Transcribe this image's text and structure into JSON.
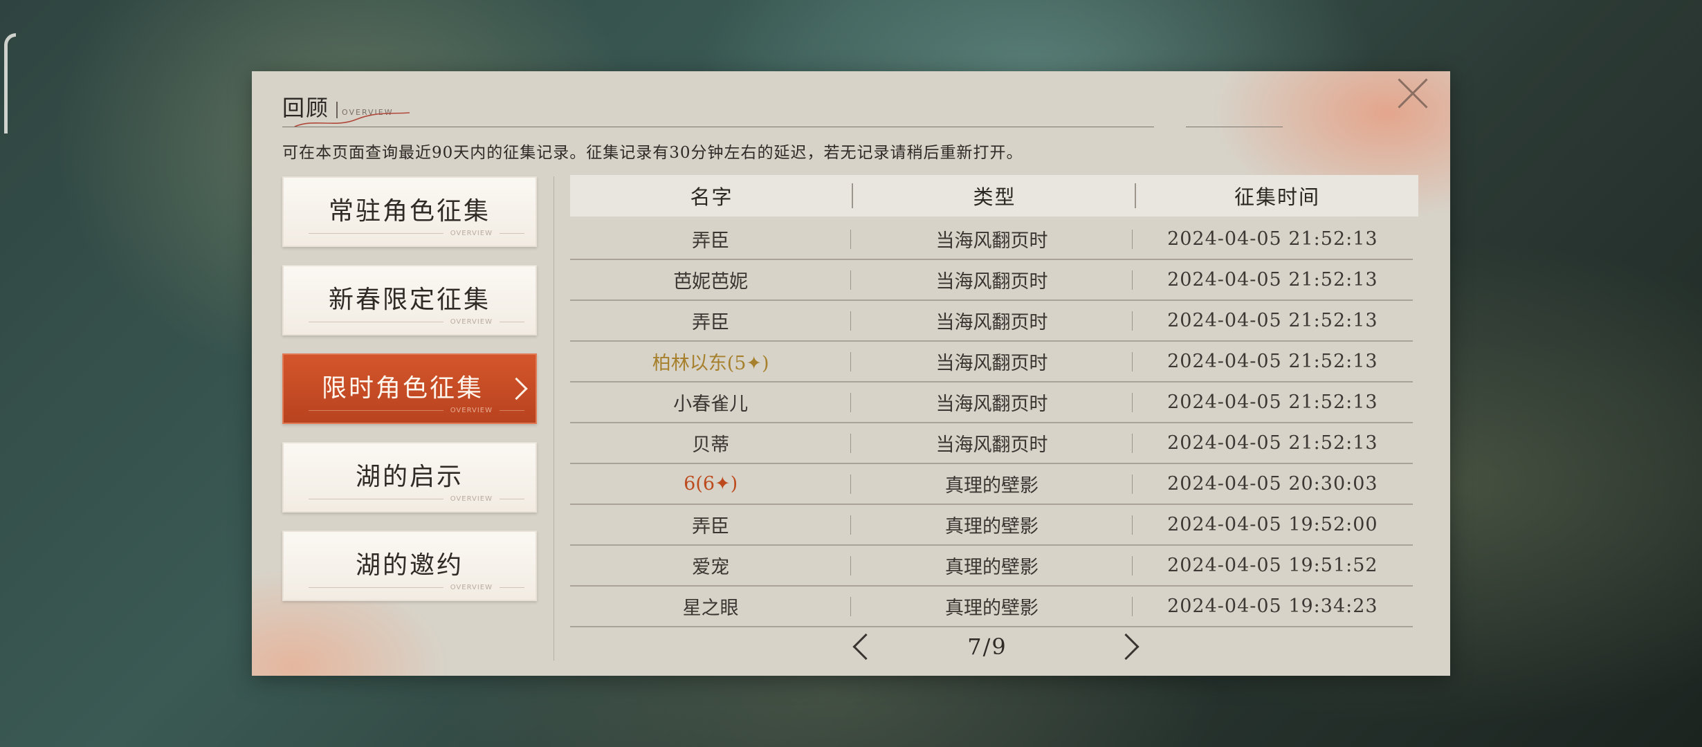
{
  "dialog": {
    "title": "回顾",
    "title_sub": "OVERVIEW",
    "notice": "可在本页面查询最近90天内的征集记录。征集记录有30分钟左右的延迟，若无记录请稍后重新打开。"
  },
  "sidebar": {
    "deco_text": "OVERVIEW",
    "items": [
      {
        "label": "常驻角色征集",
        "active": false
      },
      {
        "label": "新春限定征集",
        "active": false
      },
      {
        "label": "限时角色征集",
        "active": true
      },
      {
        "label": "湖的启示",
        "active": false
      },
      {
        "label": "湖的邀约",
        "active": false
      }
    ]
  },
  "table": {
    "headers": [
      "名字",
      "类型",
      "征集时间"
    ],
    "rows": [
      {
        "name": "弄臣",
        "type": "当海风翻页时",
        "time": "2024-04-05 21:52:13"
      },
      {
        "name": "芭妮芭妮",
        "type": "当海风翻页时",
        "time": "2024-04-05 21:52:13"
      },
      {
        "name": "弄臣",
        "type": "当海风翻页时",
        "time": "2024-04-05 21:52:13"
      },
      {
        "name": "柏林以东(5✦)",
        "type": "当海风翻页时",
        "time": "2024-04-05 21:52:13",
        "rarity": "gold"
      },
      {
        "name": "小春雀儿",
        "type": "当海风翻页时",
        "time": "2024-04-05 21:52:13"
      },
      {
        "name": "贝蒂",
        "type": "当海风翻页时",
        "time": "2024-04-05 21:52:13"
      },
      {
        "name": "6(6✦)",
        "type": "真理的壁影",
        "time": "2024-04-05 20:30:03",
        "rarity": "red"
      },
      {
        "name": "弄臣",
        "type": "真理的壁影",
        "time": "2024-04-05 19:52:00"
      },
      {
        "name": "爱宠",
        "type": "真理的壁影",
        "time": "2024-04-05 19:51:52"
      },
      {
        "name": "星之眼",
        "type": "真理的壁影",
        "time": "2024-04-05 19:34:23"
      }
    ]
  },
  "pager": {
    "text": "7/9"
  },
  "colors": {
    "active_tab": "#c44c24",
    "gold_rarity": "#a6802c",
    "red_rarity": "#bd4a1c",
    "panel_bg": "#d7d3c9"
  }
}
